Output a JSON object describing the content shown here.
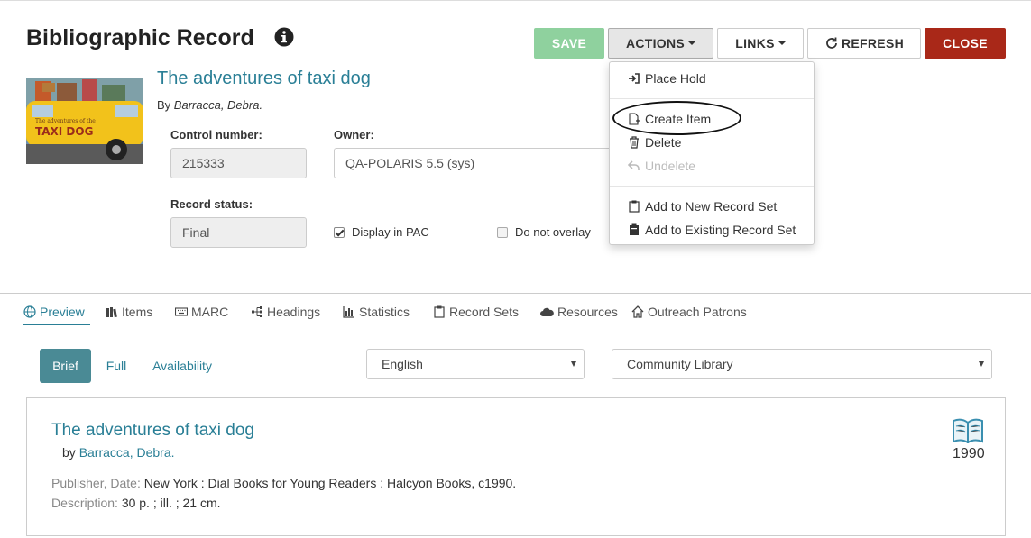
{
  "header": {
    "title": "Bibliographic Record",
    "info_icon": "info-circle-icon"
  },
  "toolbar": {
    "save": "SAVE",
    "actions": "ACTIONS",
    "links": "LINKS",
    "refresh": "REFRESH",
    "close": "CLOSE"
  },
  "record": {
    "title": "The adventures of taxi dog",
    "by_prefix": "By",
    "author": "Barracca, Debra.",
    "cover_text_top": "The adventures of the",
    "cover_title": "TAXI DOG",
    "control_number_label": "Control number:",
    "control_number": "215333",
    "owner_label": "Owner:",
    "owner": "QA-POLARIS 5.5 (sys)",
    "record_status_label": "Record status:",
    "record_status": "Final",
    "display_in_pac_label": "Display in PAC",
    "display_in_pac_checked": true,
    "do_not_overlay_label": "Do not overlay",
    "do_not_overlay_checked": false
  },
  "actions_menu": {
    "items": [
      {
        "label": "Place Hold",
        "icon": "sign-in-icon",
        "disabled": false
      },
      {
        "label": "Create Item",
        "icon": "new-file-icon",
        "disabled": false
      },
      {
        "label": "Delete",
        "icon": "trash-icon",
        "disabled": false
      },
      {
        "label": "Undelete",
        "icon": "undo-icon",
        "disabled": true
      },
      {
        "label": "Add to New Record Set",
        "icon": "clipboard-icon",
        "disabled": false
      },
      {
        "label": "Add to Existing Record Set",
        "icon": "clipboard-filled-icon",
        "disabled": false
      }
    ]
  },
  "tabs": [
    {
      "label": "Preview",
      "icon": "globe-icon",
      "active": true
    },
    {
      "label": "Items",
      "icon": "books-icon",
      "active": false
    },
    {
      "label": "MARC",
      "icon": "keyboard-icon",
      "active": false
    },
    {
      "label": "Headings",
      "icon": "sitemap-icon",
      "active": false
    },
    {
      "label": "Statistics",
      "icon": "bar-chart-icon",
      "active": false
    },
    {
      "label": "Record Sets",
      "icon": "clipboard-icon",
      "active": false
    },
    {
      "label": "Resources",
      "icon": "cloud-icon",
      "active": false
    },
    {
      "label": "Outreach Patrons",
      "icon": "home-icon",
      "active": false
    }
  ],
  "preview": {
    "views": [
      "Brief",
      "Full",
      "Availability"
    ],
    "language": "English",
    "library": "Community Library",
    "title": "The adventures of taxi dog",
    "by_prefix": "by",
    "author": "Barracca, Debra.",
    "publisher_label": "Publisher, Date:",
    "publisher": "New York : Dial Books for Young Readers : Halcyon Books, c1990.",
    "description_label": "Description:",
    "description": "30 p. ; ill. ; 21 cm.",
    "year": "1990",
    "format_icon": "book-icon"
  },
  "colors": {
    "accent": "#2a7f96",
    "save": "#8fd19e",
    "close": "#a92818",
    "brief_pill": "#4a8a95"
  }
}
